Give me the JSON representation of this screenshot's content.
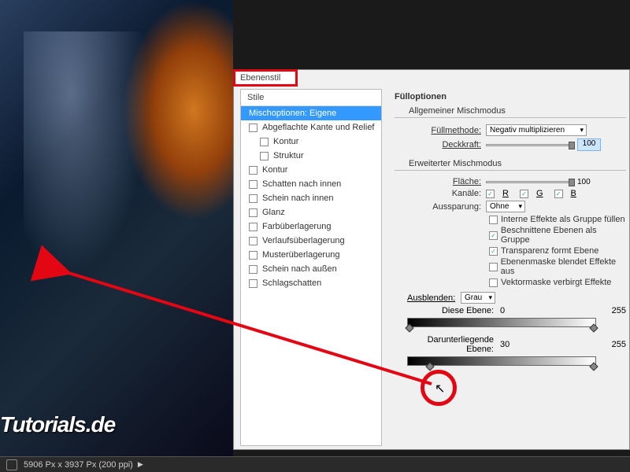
{
  "watermark": "Tutorials.de",
  "statusbar": {
    "dimensions": "5906 Px x 3937 Px (200 ppi)"
  },
  "dialog": {
    "title": "Ebenenstil",
    "styles": {
      "header": "Stile",
      "items": [
        {
          "label": "Mischoptionen: Eigene",
          "selected": true,
          "checkbox": false
        },
        {
          "label": "Abgeflachte Kante und Relief",
          "checkbox": true
        },
        {
          "label": "Kontur",
          "checkbox": true,
          "sub": true
        },
        {
          "label": "Struktur",
          "checkbox": true,
          "sub": true
        },
        {
          "label": "Kontur",
          "checkbox": true
        },
        {
          "label": "Schatten nach innen",
          "checkbox": true
        },
        {
          "label": "Schein nach innen",
          "checkbox": true
        },
        {
          "label": "Glanz",
          "checkbox": true
        },
        {
          "label": "Farbüberlagerung",
          "checkbox": true
        },
        {
          "label": "Verlaufsüberlagerung",
          "checkbox": true
        },
        {
          "label": "Musterüberlagerung",
          "checkbox": true
        },
        {
          "label": "Schein nach außen",
          "checkbox": true
        },
        {
          "label": "Schlagschatten",
          "checkbox": true
        }
      ]
    },
    "fill": {
      "title": "Fülloptionen",
      "general": {
        "title": "Allgemeiner Mischmodus",
        "blendmode_label": "Füllmethode:",
        "blendmode_value": "Negativ multiplizieren",
        "opacity_label": "Deckkraft:",
        "opacity_value": "100"
      },
      "advanced": {
        "title": "Erweiterter Mischmodus",
        "fill_label": "Fläche:",
        "fill_value": "100",
        "channels_label": "Kanäle:",
        "ch_r": "R",
        "ch_g": "G",
        "ch_b": "B",
        "knockout_label": "Aussparung:",
        "knockout_value": "Ohne",
        "opts": {
          "inner": "Interne Effekte als Gruppe füllen",
          "clipped": "Beschnittene Ebenen als Gruppe",
          "trans": "Transparenz formt Ebene",
          "layermask": "Ebenenmaske blendet Effekte aus",
          "vectormask": "Vektormaske verbirgt Effekte"
        }
      },
      "blendif": {
        "hide_label": "Ausblenden:",
        "hide_value": "Grau",
        "this_label": "Diese Ebene:",
        "this_lo": "0",
        "this_hi": "255",
        "under_label": "Darunterliegende Ebene:",
        "under_lo": "30",
        "under_hi": "255"
      }
    }
  }
}
